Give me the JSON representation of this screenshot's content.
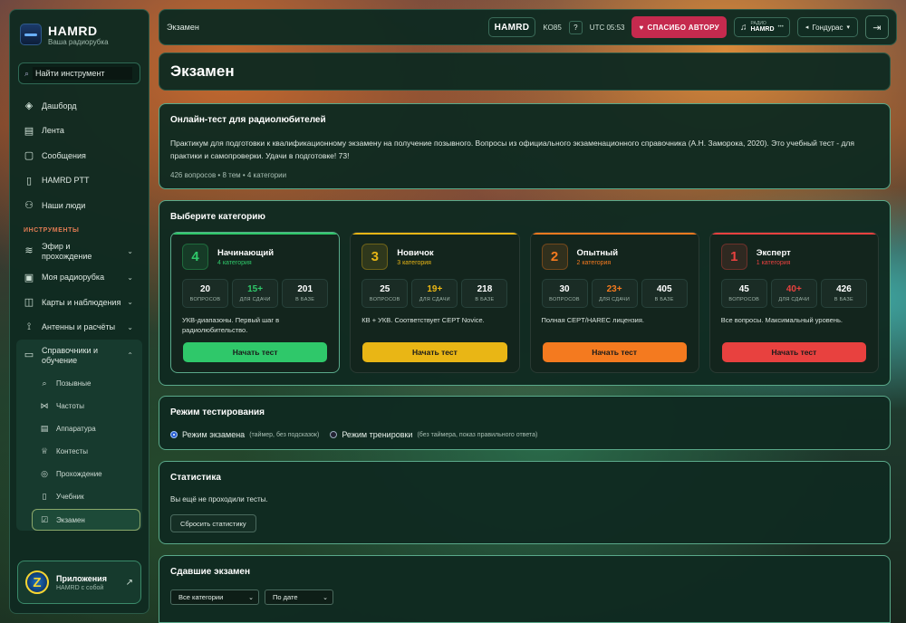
{
  "brand": {
    "name": "HAMRD",
    "subtitle": "Ваша радиорубка"
  },
  "search": {
    "placeholder": "Найти инструмент"
  },
  "nav": {
    "items": [
      {
        "label": "Дашборд",
        "icon": "layers-icon"
      },
      {
        "label": "Лента",
        "icon": "feed-icon"
      },
      {
        "label": "Сообщения",
        "icon": "message-icon"
      },
      {
        "label": "HAMRD PTT",
        "icon": "walkie-talkie-icon"
      },
      {
        "label": "Наши люди",
        "icon": "users-icon"
      }
    ],
    "section_label": "ИНСТРУМЕНТЫ",
    "tools": [
      {
        "label": "Эфир и прохождение",
        "icon": "wifi-icon"
      },
      {
        "label": "Моя радиорубка",
        "icon": "radio-icon"
      },
      {
        "label": "Карты и наблюдения",
        "icon": "map-icon"
      },
      {
        "label": "Антенны и расчёты",
        "icon": "antenna-icon"
      },
      {
        "label": "Справочники и обучение",
        "icon": "book-icon"
      }
    ],
    "sub_items": [
      {
        "label": "Позывные",
        "icon": "search-icon"
      },
      {
        "label": "Частоты",
        "icon": "frequency-icon"
      },
      {
        "label": "Аппаратура",
        "icon": "device-icon"
      },
      {
        "label": "Контесты",
        "icon": "trophy-icon"
      },
      {
        "label": "Прохождение",
        "icon": "propagation-icon"
      },
      {
        "label": "Учебник",
        "icon": "book-open-icon"
      },
      {
        "label": "Экзамен",
        "icon": "checkbox-icon"
      }
    ]
  },
  "apps": {
    "title": "Приложения",
    "subtitle": "HAMRD с собой"
  },
  "topbar": {
    "breadcrumb": "Экзамен",
    "logo": "HAMRD",
    "grid": "KO85",
    "help": "?",
    "utc": "UTC 05:53",
    "thanks": "СПАСИБО АВТОРУ",
    "radio_top": "РАДИО",
    "radio_bottom": "HAMRD",
    "country": "Гондурас"
  },
  "page": {
    "title": "Экзамен"
  },
  "intro": {
    "title": "Онлайн-тест для радиолюбителей",
    "text": "Практикум для подготовки к квалификационному экзамену на получение позывного. Вопросы из официального экзаменационного справочника (А.Н. Заморока, 2020). Это учебный тест - для практики и самопроверки. Удачи в подготовке! 73!",
    "meta": "426 вопросов • 8 тем • 4 категории"
  },
  "categories_section": {
    "title": "Выберите категорию"
  },
  "categories": [
    {
      "num": "4",
      "title": "Начинающий",
      "sub": "4 категория",
      "questions": "20",
      "questions_label": "ВОПРОСОВ",
      "pass": "15+",
      "pass_label": "ДЛЯ СДАЧИ",
      "base": "201",
      "base_label": "В БАЗЕ",
      "desc": "УКВ-диапазоны. Первый шаг в радиолюбительство.",
      "button": "Начать тест",
      "color": "#2fc86a"
    },
    {
      "num": "3",
      "title": "Новичок",
      "sub": "3 категория",
      "questions": "25",
      "questions_label": "ВОПРОСОВ",
      "pass": "19+",
      "pass_label": "ДЛЯ СДАЧИ",
      "base": "218",
      "base_label": "В БАЗЕ",
      "desc": "КВ + УКВ. Соответствует CEPT Novice.",
      "button": "Начать тест",
      "color": "#e9b615"
    },
    {
      "num": "2",
      "title": "Опытный",
      "sub": "2 категория",
      "questions": "30",
      "questions_label": "ВОПРОСОВ",
      "pass": "23+",
      "pass_label": "ДЛЯ СДАЧИ",
      "base": "405",
      "base_label": "В БАЗЕ",
      "desc": "Полная CEPT/HAREC лицензия.",
      "button": "Начать тест",
      "color": "#f47a1f"
    },
    {
      "num": "1",
      "title": "Эксперт",
      "sub": "1 категория",
      "questions": "45",
      "questions_label": "ВОПРОСОВ",
      "pass": "40+",
      "pass_label": "ДЛЯ СДАЧИ",
      "base": "426",
      "base_label": "В БАЗЕ",
      "desc": "Все вопросы. Максимальный уровень.",
      "button": "Начать тест",
      "color": "#e8413f"
    }
  ],
  "mode": {
    "title": "Режим тестирования",
    "exam_label": "Режим экзамена",
    "exam_hint": "(таймер, без подсказок)",
    "train_label": "Режим тренировки",
    "train_hint": "(без таймера, показ правильного ответа)",
    "selected": "exam"
  },
  "stats": {
    "title": "Статистика",
    "empty": "Вы ещё не проходили тесты.",
    "reset": "Сбросить статистику"
  },
  "passed": {
    "title": "Сдавшие экзамен",
    "filter_category": "Все категории",
    "sort": "По дате"
  }
}
